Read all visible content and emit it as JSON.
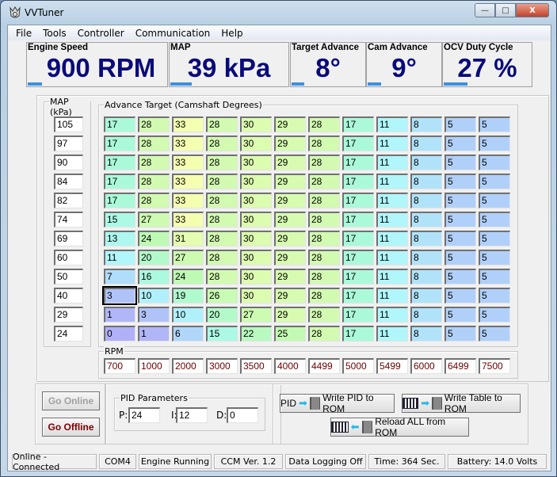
{
  "window": {
    "title": "VVTuner",
    "buttons": {
      "minimize": "—",
      "maximize": "□",
      "close": "X"
    }
  },
  "menu": [
    "File",
    "Tools",
    "Controller",
    "Communication",
    "Help"
  ],
  "gauges": [
    {
      "label": "Engine Speed",
      "value": "900 RPM",
      "progress": 0.1
    },
    {
      "label": "MAP",
      "value": "39 kPa",
      "progress": 0.18
    },
    {
      "label": "Target Advance",
      "value": "8°",
      "progress": 0.17
    },
    {
      "label": "Cam Advance",
      "value": "9°",
      "progress": 0.18
    },
    {
      "label": "OCV Duty Cycle",
      "value": "27 %",
      "progress": 0.27
    }
  ],
  "map_group": {
    "label": "MAP (kPa)",
    "values": [
      "105",
      "97",
      "90",
      "84",
      "82",
      "74",
      "69",
      "60",
      "50",
      "40",
      "29",
      "24"
    ]
  },
  "advance_group": {
    "label": "Advance Target (Camshaft Degrees)",
    "selected": [
      9,
      0
    ],
    "rows": [
      [
        17,
        28,
        33,
        28,
        30,
        29,
        28,
        17,
        11,
        8,
        5,
        5
      ],
      [
        17,
        28,
        33,
        28,
        30,
        29,
        28,
        17,
        11,
        8,
        5,
        5
      ],
      [
        17,
        28,
        33,
        28,
        30,
        29,
        28,
        17,
        11,
        8,
        5,
        5
      ],
      [
        17,
        28,
        33,
        28,
        30,
        29,
        28,
        17,
        11,
        8,
        5,
        5
      ],
      [
        17,
        28,
        33,
        28,
        30,
        29,
        28,
        17,
        11,
        8,
        5,
        5
      ],
      [
        15,
        27,
        33,
        28,
        30,
        29,
        28,
        17,
        11,
        8,
        5,
        5
      ],
      [
        13,
        24,
        31,
        28,
        30,
        29,
        28,
        17,
        11,
        8,
        5,
        5
      ],
      [
        11,
        20,
        27,
        28,
        30,
        29,
        28,
        17,
        11,
        8,
        5,
        5
      ],
      [
        7,
        16,
        24,
        28,
        30,
        29,
        28,
        17,
        11,
        8,
        5,
        5
      ],
      [
        3,
        10,
        19,
        26,
        30,
        29,
        28,
        17,
        11,
        8,
        5,
        5
      ],
      [
        1,
        3,
        10,
        20,
        27,
        29,
        28,
        17,
        11,
        8,
        5,
        5
      ],
      [
        0,
        1,
        6,
        15,
        22,
        25,
        28,
        17,
        11,
        8,
        5,
        5
      ]
    ]
  },
  "rpm_group": {
    "label": "RPM",
    "values": [
      "700",
      "1000",
      "2000",
      "3000",
      "3500",
      "4000",
      "4499",
      "5000",
      "5499",
      "6000",
      "6499",
      "7500"
    ]
  },
  "buttons": {
    "go_online": "Go Online",
    "go_offline": "Go Offline",
    "write_pid": "Write PID to ROM",
    "write_pid_prefix": "PID",
    "write_table": "Write Table to ROM",
    "reload": "Reload ALL from ROM"
  },
  "pid": {
    "label": "PID Parameters",
    "p_label": "P:",
    "p": "24",
    "i_label": "I:",
    "i": "12",
    "d_label": "D:",
    "d": "0"
  },
  "status": [
    "Online - Connected",
    "COM4",
    "Engine Running",
    "CCM Ver. 1.2",
    "Data Logging Off",
    "Time: 364 Sec.",
    "Battery: 14.0 Volts"
  ]
}
